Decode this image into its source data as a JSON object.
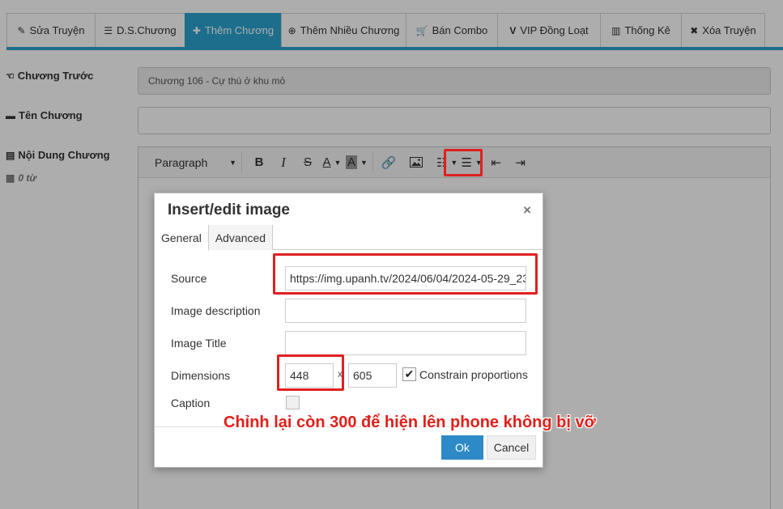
{
  "tabs": [
    {
      "icon": "edit-icon",
      "glyph": "✎",
      "label": "Sửa Truyện"
    },
    {
      "icon": "list-icon",
      "glyph": "☰",
      "label": "D.S.Chương"
    },
    {
      "icon": "plus-icon",
      "glyph": "✚",
      "label": "Thêm Chương",
      "active": true
    },
    {
      "icon": "plus-circle-icon",
      "glyph": "⊕",
      "label": "Thêm Nhiều Chương"
    },
    {
      "icon": "cart-icon",
      "glyph": "🛒",
      "label": "Bán Combo"
    },
    {
      "icon": "vip-icon",
      "glyph": "V",
      "label": "VIP Đồng Loạt"
    },
    {
      "icon": "bar-chart-icon",
      "glyph": "▥",
      "label": "Thống Kê"
    },
    {
      "icon": "close-icon",
      "glyph": "✖",
      "label": "Xóa Truyện"
    }
  ],
  "form": {
    "prev_chapter_label": "Chương Trước",
    "prev_chapter_value": "Chương 106 - Cự thú ở khu mỏ",
    "chapter_name_label": "Tên Chương",
    "chapter_name_value": "",
    "content_label": "Nội Dung Chương",
    "word_count": "0 từ"
  },
  "editor": {
    "format_select": "Paragraph"
  },
  "dialog": {
    "title": "Insert/edit image",
    "close": "×",
    "tabs": [
      "General",
      "Advanced"
    ],
    "source_label": "Source",
    "source_value": "https://img.upanh.tv/2024/06/04/2024-05-29_23",
    "image_description_label": "Image description",
    "image_description_value": "",
    "image_title_label": "Image Title",
    "image_title_value": "",
    "dimensions_label": "Dimensions",
    "width": "448",
    "height": "605",
    "times": "x",
    "constrain_label": "Constrain proportions",
    "constrain_checked": true,
    "caption_label": "Caption",
    "ok": "Ok",
    "cancel": "Cancel"
  },
  "annotation": "Chỉnh lại còn 300 để hiện lên phone không bị vỡ",
  "colors": {
    "accent": "#2aa2cf",
    "ok_button": "#2d8ac7",
    "highlight": "#e02020"
  }
}
